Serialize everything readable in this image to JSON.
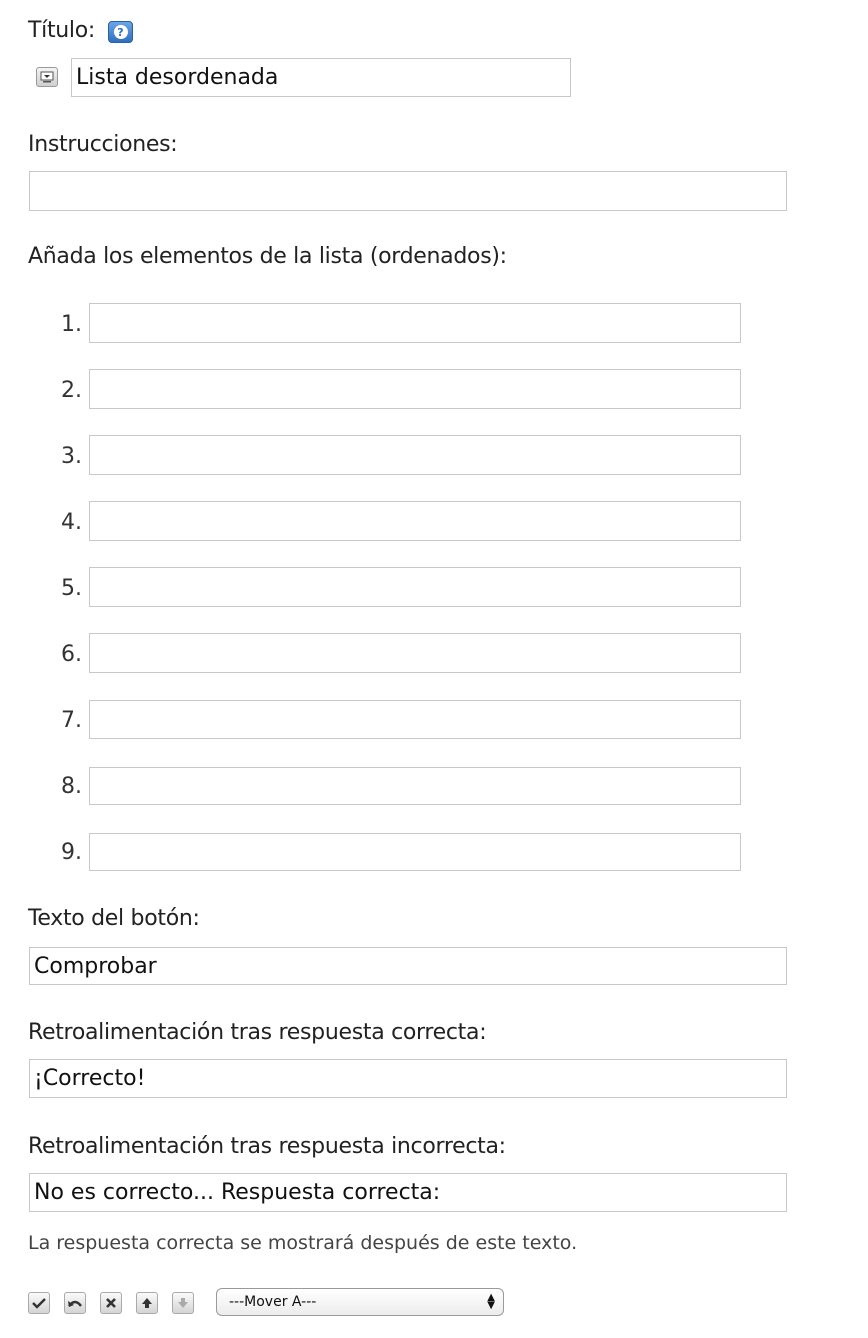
{
  "title": {
    "label": "Título:",
    "value": "Lista desordenada"
  },
  "instructions": {
    "label": "Instrucciones:",
    "value": ""
  },
  "items": {
    "label": "Añada los elementos de la lista (ordenados):",
    "list": [
      {
        "num": "1.",
        "value": ""
      },
      {
        "num": "2.",
        "value": ""
      },
      {
        "num": "3.",
        "value": ""
      },
      {
        "num": "4.",
        "value": ""
      },
      {
        "num": "5.",
        "value": ""
      },
      {
        "num": "6.",
        "value": ""
      },
      {
        "num": "7.",
        "value": ""
      },
      {
        "num": "8.",
        "value": ""
      },
      {
        "num": "9.",
        "value": ""
      }
    ]
  },
  "button_text": {
    "label": "Texto del botón:",
    "value": "Comprobar"
  },
  "correct_feedback": {
    "label": "Retroalimentación tras respuesta correcta:",
    "value": "¡Correcto!"
  },
  "incorrect_feedback": {
    "label": "Retroalimentación tras respuesta incorrecta:",
    "value": "No es correcto... Respuesta correcta:",
    "hint": "La respuesta correcta se mostrará después de este texto."
  },
  "toolbar": {
    "icons": [
      "check-icon",
      "undo-icon",
      "delete-icon",
      "move-up-icon",
      "move-down-icon"
    ],
    "move_select": "---Mover A---"
  }
}
